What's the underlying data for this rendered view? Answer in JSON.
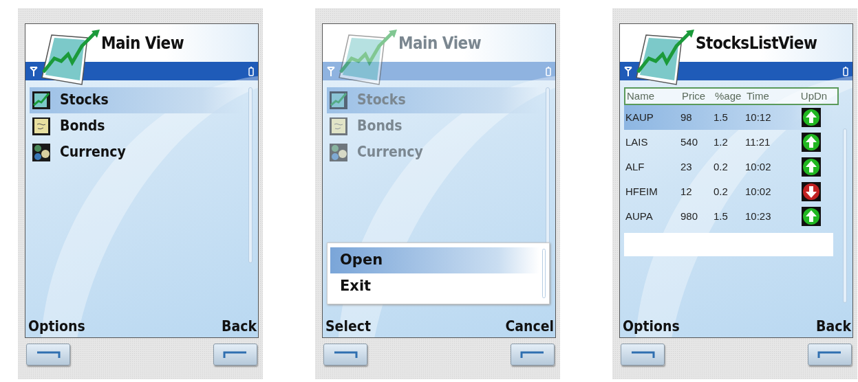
{
  "phones": [
    {
      "kind": "list",
      "title": "Main View",
      "dimmed": false,
      "items": [
        {
          "label": "Stocks",
          "selected": true
        },
        {
          "label": "Bonds",
          "selected": false
        },
        {
          "label": "Currency",
          "selected": false
        }
      ],
      "softkeys": {
        "left": "Options",
        "right": "Back"
      }
    },
    {
      "kind": "list",
      "title": "Main View",
      "dimmed": true,
      "items": [
        {
          "label": "Stocks",
          "selected": true
        },
        {
          "label": "Bonds",
          "selected": false
        },
        {
          "label": "Currency",
          "selected": false
        }
      ],
      "menu": [
        {
          "label": "Open",
          "selected": true
        },
        {
          "label": "Exit",
          "selected": false
        }
      ],
      "softkeys": {
        "left": "Select",
        "right": "Cancel"
      }
    },
    {
      "kind": "table",
      "title": "StocksListView",
      "dimmed": false,
      "columns": [
        "Name",
        "Price",
        "%age",
        "Time",
        "UpDn"
      ],
      "rows": [
        {
          "cells": [
            "KAUP",
            "98",
            "1.5",
            "10:12"
          ],
          "up": true,
          "selected": true
        },
        {
          "cells": [
            "LAIS",
            "540",
            "1.2",
            "11:21"
          ],
          "up": true,
          "selected": false
        },
        {
          "cells": [
            "ALF",
            "23",
            "0.2",
            "10:02"
          ],
          "up": true,
          "selected": false
        },
        {
          "cells": [
            "HFEIM",
            "12",
            "0.2",
            "10:02"
          ],
          "up": false,
          "selected": false
        },
        {
          "cells": [
            "AUPA",
            "980",
            "1.5",
            "10:23"
          ],
          "up": true,
          "selected": false
        }
      ],
      "softkeys": {
        "left": "Options",
        "right": "Back"
      }
    }
  ]
}
